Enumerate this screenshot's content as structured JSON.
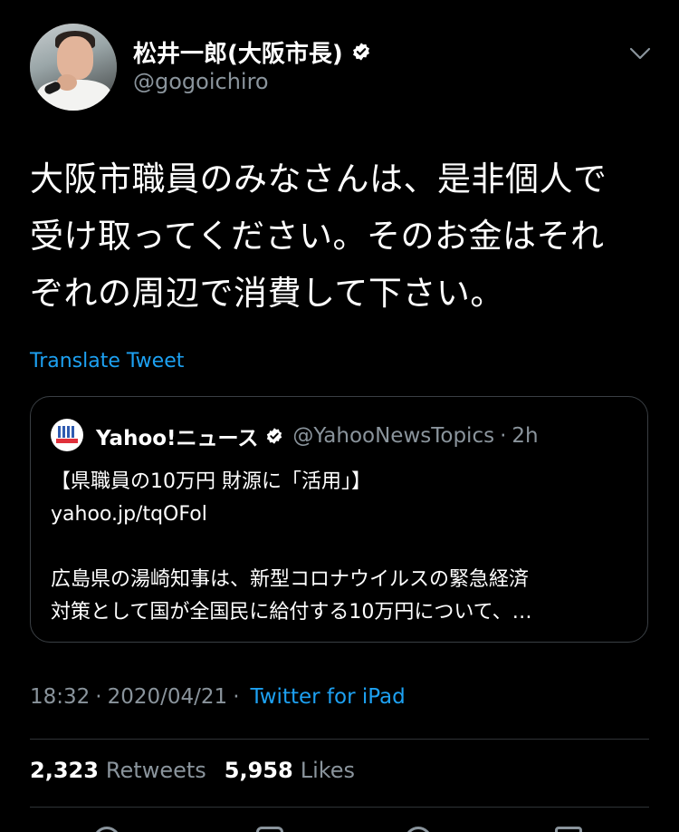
{
  "user": {
    "display_name": "松井一郎(大阪市長)",
    "handle": "@gogoichiro",
    "verified": true
  },
  "tweet": {
    "text_lines": [
      "大阪市職員のみなさんは、是非個人で",
      "受け取ってください。そのお金はそれ",
      "ぞれの周辺で消費して下さい。"
    ],
    "translate_label": "Translate Tweet"
  },
  "quoted_tweet": {
    "display_name": "Yahoo!ニュース",
    "verified": true,
    "handle": "@YahooNewsTopics",
    "separator": "·",
    "time": "2h",
    "lines": [
      "【県職員の10万円 財源に「活用」】",
      "yahoo.jp/tqOFol",
      "",
      "広島県の湯崎知事は、新型コロナウイルスの緊急経済",
      "対策として国が全国民に給付する10万円について、…"
    ]
  },
  "meta": {
    "time": "18:32",
    "separator": "·",
    "date": "2020/04/21",
    "source": "Twitter for iPad"
  },
  "stats": {
    "retweets_count": "2,323",
    "retweets_label": "Retweets",
    "likes_count": "5,958",
    "likes_label": "Likes"
  },
  "icons": {
    "verified": "verified-badge-icon",
    "more": "chevron-down-icon"
  },
  "colors": {
    "background": "#000000",
    "accent": "#1da1f2",
    "secondary_text": "#8a949c",
    "divider": "#2f3336"
  }
}
